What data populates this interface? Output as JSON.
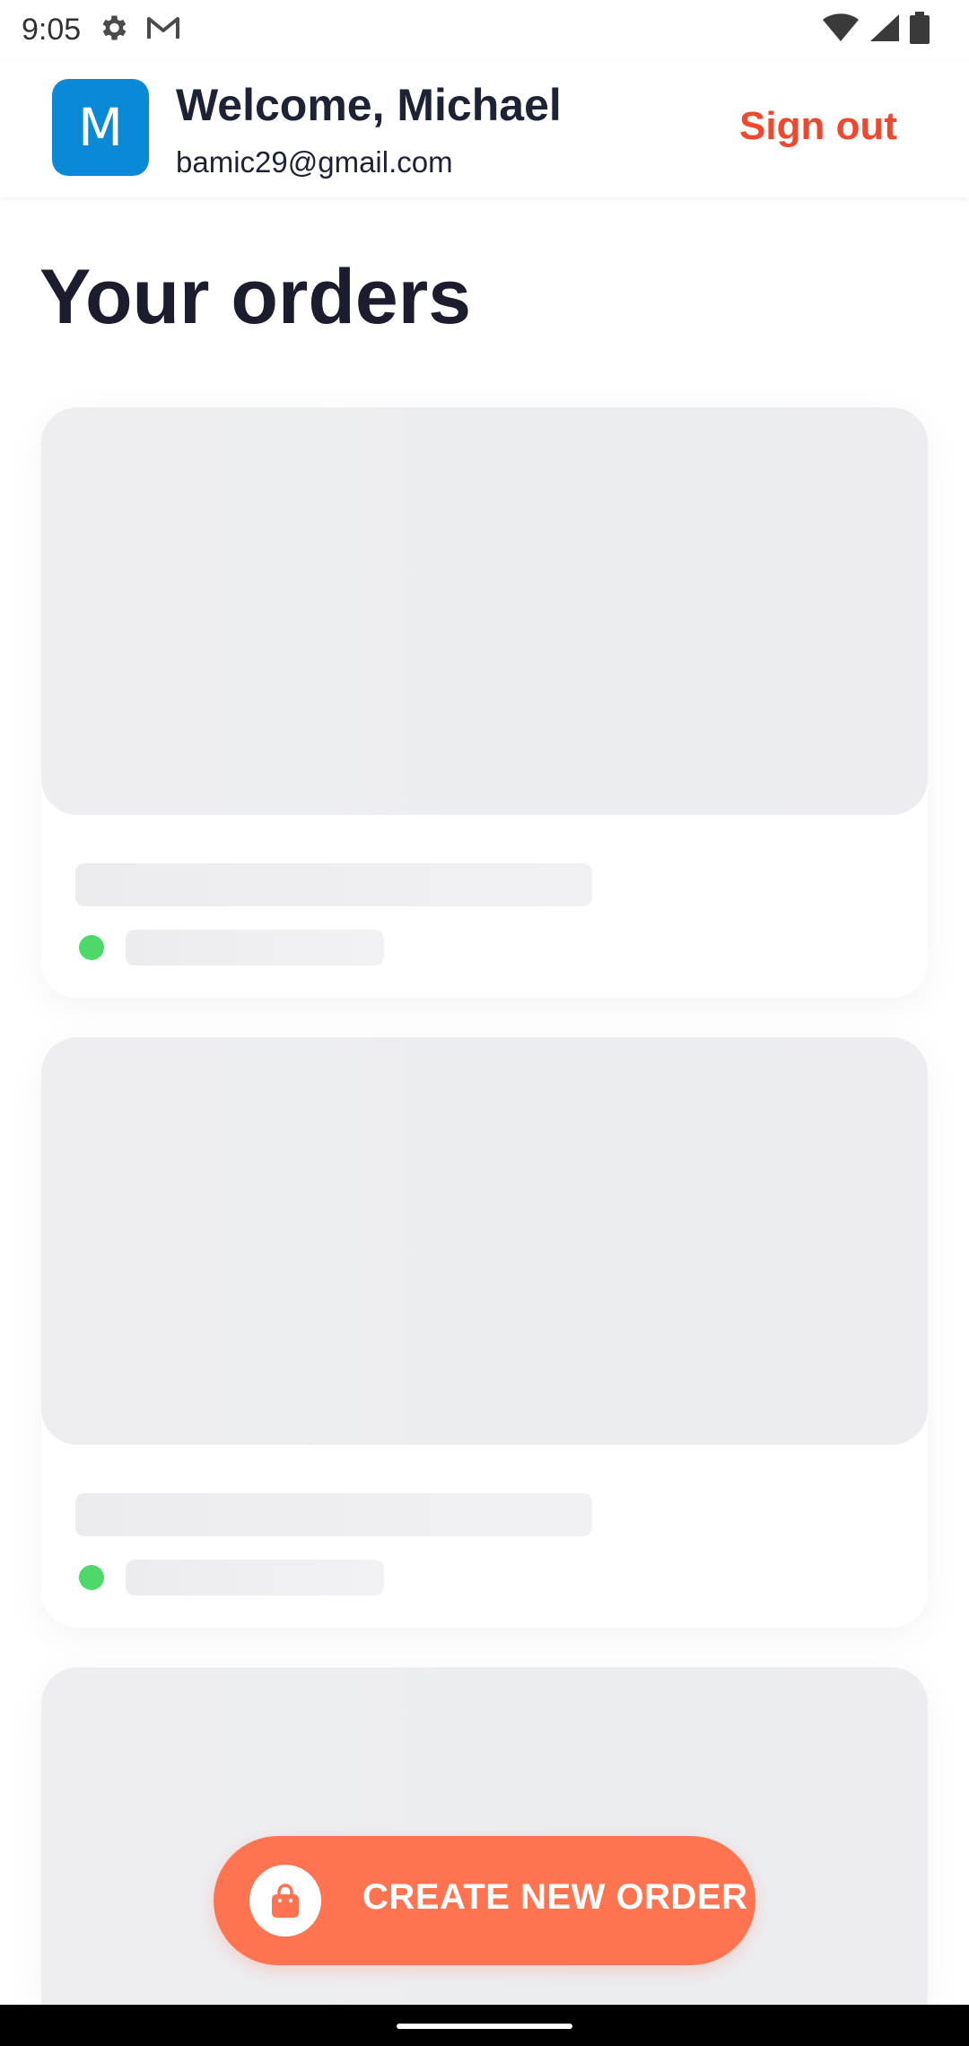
{
  "status_bar": {
    "time": "9:05",
    "icons_left": [
      "gear-icon",
      "gmail-icon"
    ],
    "icons_right": [
      "wifi-icon",
      "signal-icon",
      "battery-icon"
    ]
  },
  "header": {
    "avatar_letter": "M",
    "welcome": "Welcome, Michael",
    "email": "bamic29@gmail.com",
    "sign_out_label": "Sign out"
  },
  "page": {
    "title": "Your orders"
  },
  "orders": {
    "loading": true,
    "status_color": "#4dd86a"
  },
  "fab": {
    "label": "CREATE NEW ORDER",
    "icon": "shopping-bag-icon",
    "color": "#ff7450"
  },
  "colors": {
    "accent": "#f0482e",
    "avatar": "#0a8ad6",
    "text_dark": "#1e2235"
  }
}
